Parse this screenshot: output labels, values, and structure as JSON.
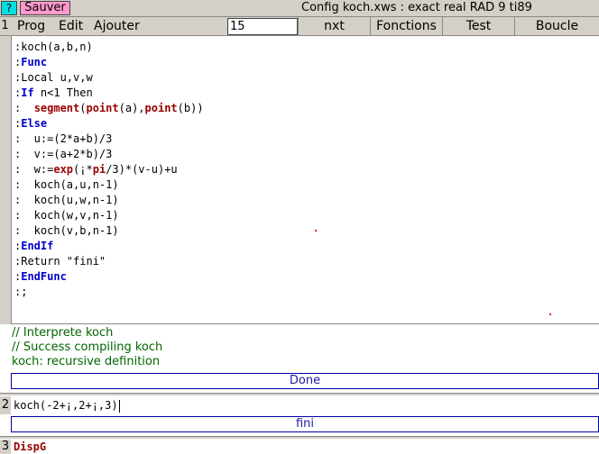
{
  "titlebar": {
    "help_label": "?",
    "save_label": "Sauver",
    "config_title": "Config koch.xws : exact real RAD 9 ti89"
  },
  "menubar": {
    "row_number": "1",
    "prog": "Prog",
    "edit": "Edit",
    "ajouter": "Ajouter",
    "level_value": "15",
    "nxt": "nxt",
    "fonctions": "Fonctions",
    "test": "Test",
    "boucle": "Boucle"
  },
  "code_lines": [
    [
      {
        "t": ":koch(a,b,n)"
      }
    ],
    [
      {
        "t": ":"
      },
      {
        "t": "Func",
        "c": "kw"
      }
    ],
    [
      {
        "t": ":Local u,v,w"
      }
    ],
    [
      {
        "t": ":"
      },
      {
        "t": "If",
        "c": "kw"
      },
      {
        "t": " n<1 Then"
      }
    ],
    [
      {
        "t": ":  "
      },
      {
        "t": "segment",
        "c": "fn"
      },
      {
        "t": "("
      },
      {
        "t": "point",
        "c": "fn"
      },
      {
        "t": "(a),"
      },
      {
        "t": "point",
        "c": "fn"
      },
      {
        "t": "(b))"
      }
    ],
    [
      {
        "t": ":"
      },
      {
        "t": "Else",
        "c": "kw"
      }
    ],
    [
      {
        "t": ":  u:=(2*a+b)/3"
      }
    ],
    [
      {
        "t": ":  v:=(a+2*b)/3"
      }
    ],
    [
      {
        "t": ":  w:="
      },
      {
        "t": "exp",
        "c": "fn"
      },
      {
        "t": "(¡*"
      },
      {
        "t": "pi",
        "c": "fn"
      },
      {
        "t": "/3)*(v-u)+u"
      }
    ],
    [
      {
        "t": ":  koch(a,u,n-1)"
      }
    ],
    [
      {
        "t": ":  koch(u,w,n-1)"
      }
    ],
    [
      {
        "t": ":  koch(w,v,n-1)"
      }
    ],
    [
      {
        "t": ":  koch(v,b,n-1)"
      }
    ],
    [
      {
        "t": ":"
      },
      {
        "t": "EndIf",
        "c": "kw"
      }
    ],
    [
      {
        "t": ":Return \"fini\""
      }
    ],
    [
      {
        "t": ":"
      },
      {
        "t": "EndFunc",
        "c": "kw"
      }
    ],
    [
      {
        "t": ":;"
      }
    ]
  ],
  "messages": {
    "line1": "// Interprete koch",
    "line2": "// Success compiling koch",
    "line3": "koch: recursive definition"
  },
  "results": {
    "done": "Done",
    "fini": "fini"
  },
  "history": {
    "row2_number": "2",
    "row2_input": "koch(-2+¡,2+¡,3)",
    "row3_number": "3",
    "row3_input": "DispG"
  },
  "colors": {
    "keyword": "#0000cc",
    "function": "#990000",
    "message": "#006600",
    "result": "#1a1aa6",
    "save_button": "#ff99cc",
    "help_button": "#00e0e0"
  }
}
